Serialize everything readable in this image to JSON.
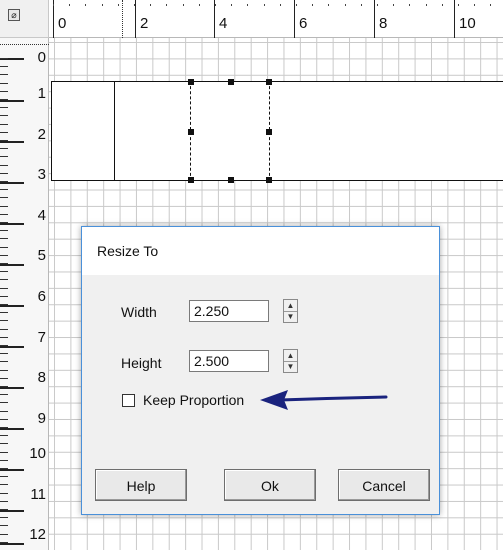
{
  "ruler": {
    "corner_icon": "ruler-settings-icon",
    "horizontal_labels": [
      "0",
      "2",
      "4",
      "6",
      "8",
      "10"
    ],
    "vertical_labels": [
      "0",
      "1",
      "2",
      "3",
      "4",
      "5",
      "6",
      "7",
      "8",
      "9",
      "10",
      "11",
      "12"
    ]
  },
  "dialog": {
    "title": "Resize To",
    "width_label": "Width",
    "width_value": "2.250",
    "height_label": "Height",
    "height_value": "2.500",
    "keep_proportion_label": "Keep Proportion",
    "keep_proportion_checked": false,
    "help_label": "Help",
    "ok_label": "Ok",
    "cancel_label": "Cancel"
  },
  "annotation": {
    "arrow_icon": "blue-arrow-icon",
    "color": "#1a237e"
  }
}
